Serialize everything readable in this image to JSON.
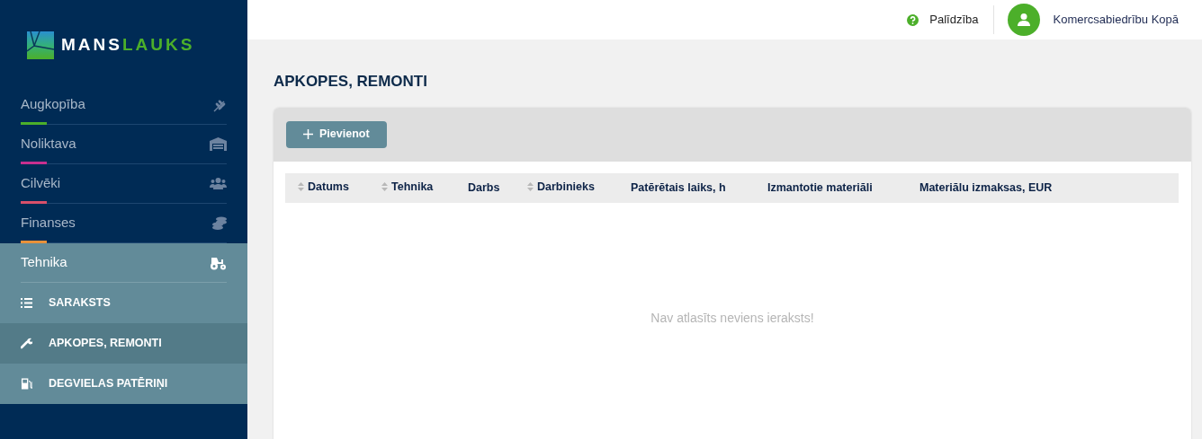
{
  "logo": {
    "part_1": "MANS",
    "part_2": "LAUKS"
  },
  "sidebar": {
    "items": [
      {
        "label": "Augkopība",
        "color": "#4caf2a",
        "expanded": false
      },
      {
        "label": "Noliktava",
        "color": "#c8308f",
        "expanded": false
      },
      {
        "label": "Cilvēki",
        "color": "#d9506a",
        "expanded": false
      },
      {
        "label": "Finanses",
        "color": "#e8913a",
        "expanded": false
      },
      {
        "label": "Tehnika",
        "expanded": true,
        "children": [
          {
            "label": "SARAKSTS",
            "selected": false
          },
          {
            "label": "APKOPES, REMONTI",
            "selected": true
          },
          {
            "label": "DEGVIELAS PATĒRIŅI",
            "selected": false
          }
        ]
      }
    ]
  },
  "topbar": {
    "help": "Palīdzība",
    "user": "Komercsabiedrību Kopā"
  },
  "page_title": "APKOPES, REMONTI",
  "add_button": "Pievienot",
  "table": {
    "columns": [
      {
        "label": "Datums",
        "sortable": true
      },
      {
        "label": "Tehnika",
        "sortable": true
      },
      {
        "label": "Darbs",
        "sortable": false
      },
      {
        "label": "Darbinieks",
        "sortable": true
      },
      {
        "label": "Patērētais laiks, h",
        "sortable": false
      },
      {
        "label": "Izmantotie materiāli",
        "sortable": false
      },
      {
        "label": "Materiālu izmaksas, EUR",
        "sortable": false
      }
    ],
    "empty_message": "Nav atlasīts neviens ieraksts!"
  }
}
